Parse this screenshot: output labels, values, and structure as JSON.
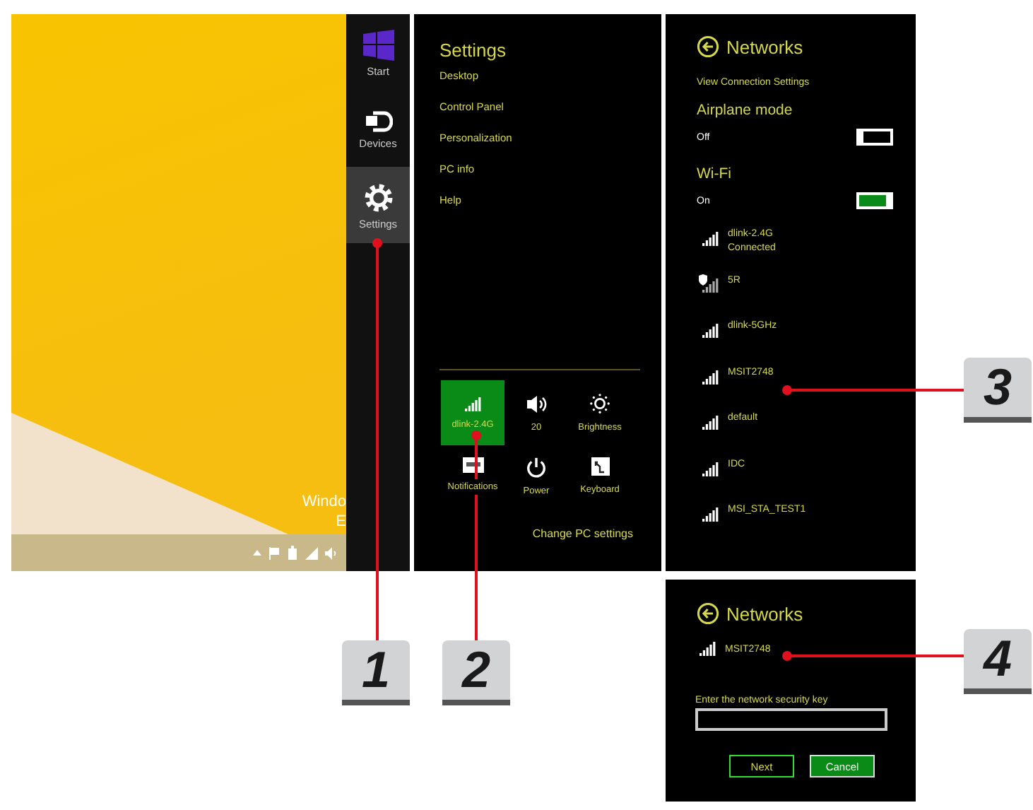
{
  "desktop": {
    "texts": [
      "Windo",
      "E"
    ]
  },
  "charms": [
    {
      "label": "Start",
      "kind": "start",
      "selected": false
    },
    {
      "label": "Devices",
      "kind": "devices",
      "selected": false
    },
    {
      "label": "Settings",
      "kind": "settings",
      "selected": true
    }
  ],
  "settings_panel": {
    "title": "Settings",
    "links": [
      "Desktop",
      "Control Panel",
      "Personalization",
      "PC info",
      "Help"
    ],
    "quick_settings": [
      {
        "label": "dlink-2.4G",
        "kind": "wifi",
        "selected": true
      },
      {
        "label": "20",
        "kind": "volume",
        "selected": false
      },
      {
        "label": "Brightness",
        "kind": "brightness",
        "selected": false
      },
      {
        "label": "Notifications",
        "kind": "notifications",
        "selected": false
      },
      {
        "label": "Power",
        "kind": "power",
        "selected": false
      },
      {
        "label": "Keyboard",
        "kind": "keyboard",
        "selected": false
      }
    ],
    "footer_link": "Change PC settings"
  },
  "networks_panel": {
    "title": "Networks",
    "link": "View Connection Settings",
    "switches": [
      {
        "title": "Airplane mode",
        "state_label": "Off",
        "on": false
      },
      {
        "title": "Wi-Fi",
        "state_label": "On",
        "on": true
      }
    ],
    "networks": [
      {
        "name": "dlink-2.4G",
        "status": "Connected",
        "shielded": false
      },
      {
        "name": "5R",
        "shielded": true
      },
      {
        "name": "dlink-5GHz",
        "shielded": false
      },
      {
        "name": "MSIT2748",
        "shielded": false
      },
      {
        "name": "default",
        "shielded": false
      },
      {
        "name": "IDC",
        "shielded": false
      },
      {
        "name": "MSI_STA_TEST1",
        "shielded": false
      }
    ]
  },
  "connect_panel": {
    "title": "Networks",
    "network": "MSIT2748",
    "prompt": "Enter the network security key",
    "buttons": [
      {
        "label": "Next",
        "kind": "outline"
      },
      {
        "label": "Cancel",
        "kind": "filled"
      }
    ]
  },
  "callouts": [
    "1",
    "2",
    "3",
    "4"
  ]
}
